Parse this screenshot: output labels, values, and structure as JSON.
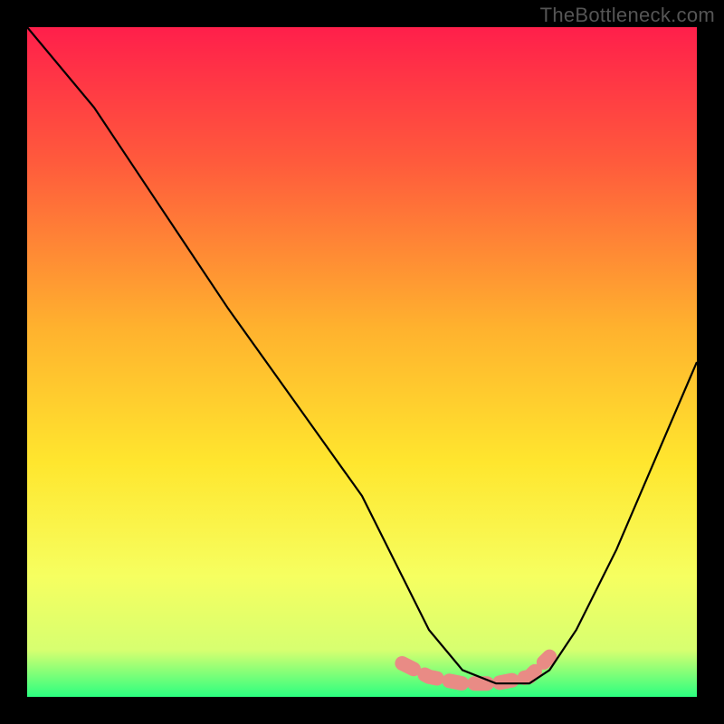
{
  "watermark": "TheBottleneck.com",
  "chart_data": {
    "type": "line",
    "title": "",
    "xlabel": "",
    "ylabel": "",
    "xlim": [
      0,
      100
    ],
    "ylim": [
      0,
      100
    ],
    "grid": false,
    "legend": "none",
    "gradient_stops": [
      {
        "offset": 0,
        "color": "#ff1f4b"
      },
      {
        "offset": 20,
        "color": "#ff5a3c"
      },
      {
        "offset": 45,
        "color": "#ffb22e"
      },
      {
        "offset": 65,
        "color": "#ffe62e"
      },
      {
        "offset": 82,
        "color": "#f6ff60"
      },
      {
        "offset": 93,
        "color": "#d7ff70"
      },
      {
        "offset": 100,
        "color": "#2bff80"
      }
    ],
    "series": [
      {
        "name": "bottleneck-curve",
        "color": "#000000",
        "x": [
          0,
          10,
          20,
          30,
          40,
          50,
          56,
          60,
          65,
          70,
          75,
          78,
          82,
          88,
          94,
          100
        ],
        "y": [
          100,
          88,
          73,
          58,
          44,
          30,
          18,
          10,
          4,
          2,
          2,
          4,
          10,
          22,
          36,
          50
        ]
      }
    ],
    "highlight_band": {
      "color": "#e98b85",
      "x": [
        56,
        60,
        65,
        70,
        75,
        78
      ],
      "y": [
        5,
        3,
        2,
        2,
        3,
        6
      ]
    }
  }
}
